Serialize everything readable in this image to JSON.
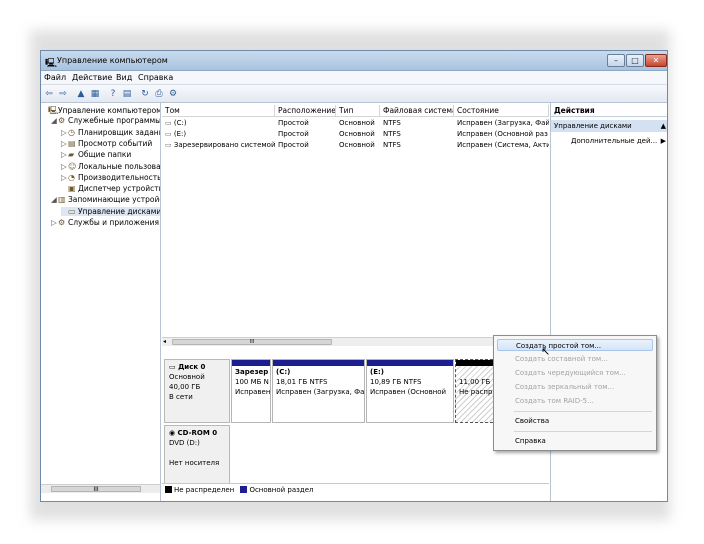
{
  "window": {
    "title": "Управление компьютером",
    "buttons": {
      "minimize": "–",
      "maximize": "□",
      "close": "✕"
    }
  },
  "menu": [
    "Файл",
    "Действие",
    "Вид",
    "Справка"
  ],
  "tree": [
    {
      "label": "Управление компьютером (л",
      "indent": 0,
      "expander": "",
      "icon": "computer-management-icon",
      "glyph": "🖳"
    },
    {
      "label": "Служебные программы",
      "indent": 1,
      "expander": "◢",
      "icon": "tools-icon",
      "glyph": "⚙"
    },
    {
      "label": "Планировщик заданий",
      "indent": 2,
      "expander": "▷",
      "icon": "clock-icon",
      "glyph": "◷"
    },
    {
      "label": "Просмотр событий",
      "indent": 2,
      "expander": "▷",
      "icon": "event-viewer-icon",
      "glyph": "▤"
    },
    {
      "label": "Общие папки",
      "indent": 2,
      "expander": "▷",
      "icon": "folder-icon",
      "glyph": "▰"
    },
    {
      "label": "Локальные пользовате",
      "indent": 2,
      "expander": "▷",
      "icon": "users-icon",
      "glyph": "☺"
    },
    {
      "label": "Производительность",
      "indent": 2,
      "expander": "▷",
      "icon": "performance-icon",
      "glyph": "◔"
    },
    {
      "label": "Диспетчер устройств",
      "indent": 2,
      "expander": "",
      "icon": "device-manager-icon",
      "glyph": "▣"
    },
    {
      "label": "Запоминающие устройст",
      "indent": 1,
      "expander": "◢",
      "icon": "storage-icon",
      "glyph": "▥"
    },
    {
      "label": "Управление дисками",
      "indent": 2,
      "expander": "",
      "icon": "disk-management-icon",
      "glyph": "▭",
      "selected": true
    },
    {
      "label": "Службы и приложения",
      "indent": 1,
      "expander": "▷",
      "icon": "services-icon",
      "glyph": "⚙"
    }
  ],
  "volumes": {
    "columns": [
      "Том",
      "Расположение",
      "Тип",
      "Файловая система",
      "Состояние"
    ],
    "rows": [
      [
        "(C:)",
        "Простой",
        "Основной",
        "NTFS",
        "Исправен (Загрузка, Фай"
      ],
      [
        "(E:)",
        "Простой",
        "Основной",
        "NTFS",
        "Исправен (Основной раз"
      ],
      [
        "Зарезервировано системой",
        "Простой",
        "Основной",
        "NTFS",
        "Исправен (Система, Акти"
      ]
    ]
  },
  "disks": {
    "disk0": {
      "name": "Диск 0",
      "lines": [
        "Основной",
        "40,00 ГБ",
        "В сети"
      ],
      "partitions": [
        {
          "title": "Зарезер",
          "size": "100 МБ N",
          "status": "Исправен"
        },
        {
          "title": "(C:)",
          "size": "18,01 ГБ NTFS",
          "status": "Исправен (Загрузка, Фа"
        },
        {
          "title": "(E:)",
          "size": "10,89 ГБ NTFS",
          "status": "Исправен (Основной"
        },
        {
          "title": "",
          "size": "11,00 ГБ",
          "status": "Не распр"
        }
      ]
    },
    "cdrom0": {
      "name": "CD-ROM 0",
      "lines": [
        "DVD (D:)",
        "",
        "Нет носителя"
      ]
    }
  },
  "legend": [
    {
      "label": "Не распределен",
      "color": "#000000"
    },
    {
      "label": "Основной раздел",
      "color": "#1b1f8f"
    }
  ],
  "actions": {
    "header": "Действия",
    "selected": "Управление дисками",
    "more": "Дополнительные дей..."
  },
  "context_menu": {
    "items": [
      {
        "label": "Создать простой том...",
        "enabled": true,
        "highlighted": true
      },
      {
        "label": "Создать составной том...",
        "enabled": false
      },
      {
        "label": "Создать чередующийся том...",
        "enabled": false
      },
      {
        "label": "Создать зеркальный том...",
        "enabled": false
      },
      {
        "label": "Создать том RAID-5...",
        "enabled": false
      },
      {
        "label": "Свойства",
        "enabled": true
      },
      {
        "label": "Справка",
        "enabled": true
      }
    ]
  },
  "scroll_thumb": "III"
}
